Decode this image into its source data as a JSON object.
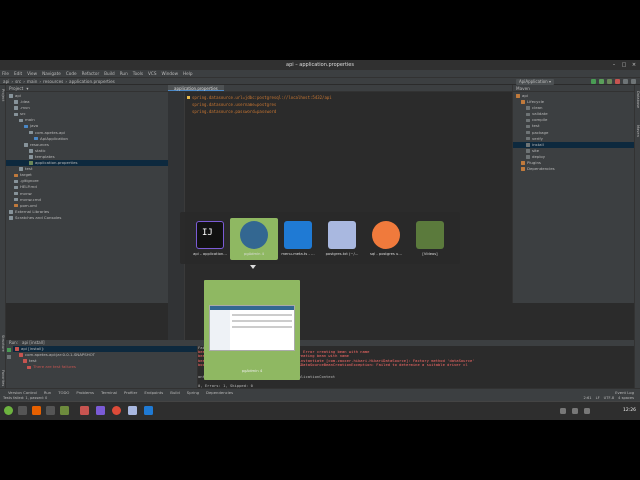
{
  "window": {
    "title": "api – application.properties"
  },
  "menu": [
    "File",
    "Edit",
    "View",
    "Navigate",
    "Code",
    "Refactor",
    "Build",
    "Run",
    "Tools",
    "VCS",
    "Window",
    "Help"
  ],
  "breadcrumb": [
    "api",
    "src",
    "main",
    "resources",
    "application.properties"
  ],
  "run_config": "ApiApplication",
  "project_panel": {
    "title": "Project",
    "rows": [
      {
        "label": "api",
        "indent": 0,
        "color": "#87939a"
      },
      {
        "label": ".idea",
        "indent": 1,
        "color": "#87939a"
      },
      {
        "label": ".mvn",
        "indent": 1,
        "color": "#87939a"
      },
      {
        "label": "src",
        "indent": 1,
        "color": "#87939a"
      },
      {
        "label": "main",
        "indent": 2,
        "color": "#87939a"
      },
      {
        "label": "java",
        "indent": 3,
        "color": "#4a88c7"
      },
      {
        "label": "com.apetes.api",
        "indent": 4,
        "color": "#87939a"
      },
      {
        "label": "ApiApplication",
        "indent": 5,
        "color": "#4a88c7"
      },
      {
        "label": "resources",
        "indent": 3,
        "color": "#87939a"
      },
      {
        "label": "static",
        "indent": 4,
        "color": "#87939a"
      },
      {
        "label": "templates",
        "indent": 4,
        "color": "#87939a"
      },
      {
        "label": "application.properties",
        "indent": 4,
        "color": "#6a8759"
      },
      {
        "label": "test",
        "indent": 2,
        "color": "#87939a"
      },
      {
        "label": "target",
        "indent": 1,
        "color": "#c07a3c"
      },
      {
        "label": ".gitignore",
        "indent": 1,
        "color": "#87939a"
      },
      {
        "label": "HELP.md",
        "indent": 1,
        "color": "#87939a"
      },
      {
        "label": "mvnw",
        "indent": 1,
        "color": "#87939a"
      },
      {
        "label": "mvnw.cmd",
        "indent": 1,
        "color": "#87939a"
      },
      {
        "label": "pom.xml",
        "indent": 1,
        "color": "#c07a3c"
      },
      {
        "label": "External Libraries",
        "indent": 0,
        "color": "#87939a"
      },
      {
        "label": "Scratches and Consoles",
        "indent": 0,
        "color": "#87939a"
      }
    ]
  },
  "editor": {
    "tab": "application.properties",
    "lines": [
      "spring.datasource.url=jdbc:postgresql://localhost:5432/api",
      "spring.datasource.username=postgres",
      "spring.datasource.password=password"
    ]
  },
  "maven_panel": {
    "title": "Maven",
    "rows": [
      {
        "label": "api",
        "indent": 0
      },
      {
        "label": "Lifecycle",
        "indent": 1
      },
      {
        "label": "clean",
        "indent": 2
      },
      {
        "label": "validate",
        "indent": 2
      },
      {
        "label": "compile",
        "indent": 2
      },
      {
        "label": "test",
        "indent": 2
      },
      {
        "label": "package",
        "indent": 2
      },
      {
        "label": "verify",
        "indent": 2
      },
      {
        "label": "install",
        "indent": 2
      },
      {
        "label": "site",
        "indent": 2
      },
      {
        "label": "deploy",
        "indent": 2
      },
      {
        "label": "Plugins",
        "indent": 1
      },
      {
        "label": "Dependencies",
        "indent": 1
      }
    ]
  },
  "run_panel": {
    "title": "Run:",
    "tab": "api [install]",
    "tree": [
      "api [install]:",
      "com.apetes.api:jar:0.0.1-SNAPSHOT",
      "test",
      "There are test failures"
    ],
    "console": [
      "Failed to load ApplicationContext",
      "beans.factory.UnsatisfiedDependencyException: Error creating bean with name",
      "beans.factory.BeanCreationException: Error creating bean with name",
      "beans.BeanInstantiationException: Failed to instantiate [com.zaxxer.hikari.HikariDataSource]: Factory method 'dataSource'",
      "boot.autoconfigure.jdbc.DataSourceProperties$DataSourceBeanCreationException: Failed to determine a suitable driver cl",
      "",
      "",
      "ontextLoads » IllegalState Failed to load ApplicationContext",
      "",
      "0, Errors: 1, Skipped: 0"
    ]
  },
  "tool_windows": [
    "Version Control",
    "Run",
    "TODO",
    "Problems",
    "Terminal",
    "Profiler",
    "Endpoints",
    "Build",
    "Spring",
    "Dependencies"
  ],
  "event_log": "Event Log",
  "status_bar": {
    "message": "Tests failed: 1, passed: 0",
    "position": "2:61",
    "line_sep": "LF",
    "encoding": "UTF-8",
    "indent": "4 spaces"
  },
  "switcher": {
    "apps": [
      {
        "label": "api – application…",
        "color": "#7b5bd6"
      },
      {
        "label": "pgAdmin 4",
        "color": "#336791"
      },
      {
        "label": "menu-meta.ts - …",
        "color": "#1f7ad4"
      },
      {
        "label": "postgres.txt (~/…",
        "color": "#a9b8e0"
      },
      {
        "label": "sql - postgres u…",
        "color": "#f07a3c"
      },
      {
        "label": "[Vídeos]",
        "color": "#5b7a3c"
      }
    ],
    "preview_label": "pgAdmin 4"
  },
  "clock": "12:26"
}
